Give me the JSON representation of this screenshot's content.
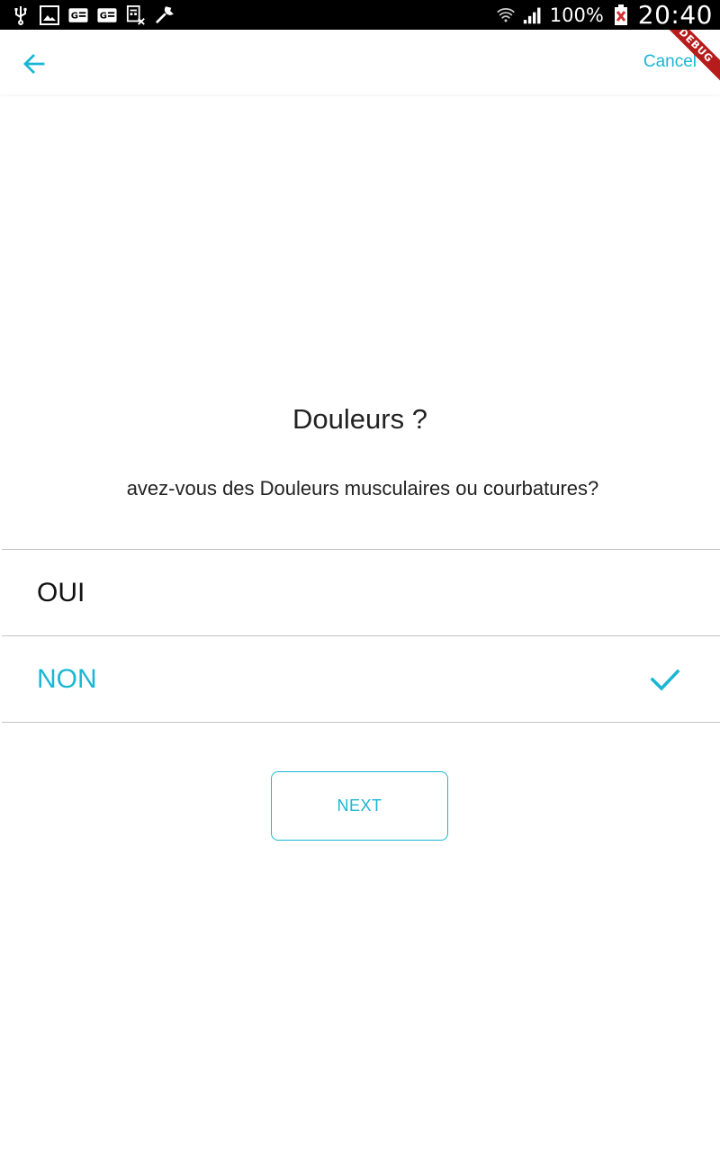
{
  "status_bar": {
    "battery_percent": "100%",
    "time": "20:40",
    "icons_left": [
      "usb-icon",
      "image-icon",
      "gmail-icon",
      "gmail-icon",
      "calc-icon",
      "wrench-icon"
    ],
    "icons_right": [
      "wifi-icon",
      "signal-icon",
      "battery-icon"
    ]
  },
  "appbar": {
    "back_icon": "arrow-left-icon",
    "cancel_label": "Cancel",
    "debug_label": "DEBUG"
  },
  "question": {
    "title": "Douleurs ?",
    "text": "avez-vous des Douleurs musculaires ou courbatures?"
  },
  "options": [
    {
      "label": "OUI",
      "selected": false
    },
    {
      "label": "NON",
      "selected": true
    }
  ],
  "next_label": "NEXT",
  "colors": {
    "accent": "#1ab7d3",
    "text": "#222222",
    "divider": "#c4c4c4"
  }
}
